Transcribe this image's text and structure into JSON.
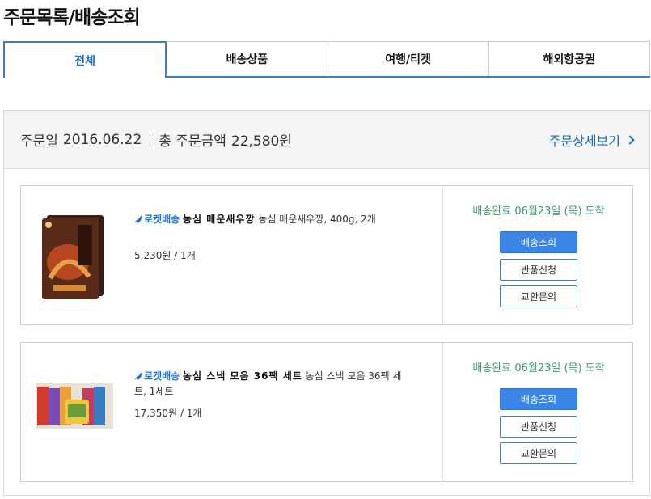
{
  "page": {
    "title": "주문목록/배송조회"
  },
  "tabs": [
    {
      "label": "전체",
      "active": true
    },
    {
      "label": "배송상품",
      "active": false
    },
    {
      "label": "여행/티켓",
      "active": false
    },
    {
      "label": "해외항공권",
      "active": false
    }
  ],
  "order": {
    "date_label": "주문일",
    "date": "2016.06.22",
    "total_label": "총 주문금액",
    "total": "22,580원",
    "detail_link": "주문상세보기",
    "items": [
      {
        "badge": "로켓배송",
        "name": "농심 매운새우깡",
        "desc": "농심 매운새우깡, 400g, 2개",
        "desc_line2": "",
        "price": "5,230원 / 1개",
        "status": "배송완료 06월23일 (목) 도착",
        "track_btn": "배송조회",
        "return_btn": "반품신청",
        "exchange_btn": "교환문의"
      },
      {
        "badge": "로켓배송",
        "name": "농심 스낵 모음 36팩 세트",
        "desc": "농심 스낵 모음 36팩 세",
        "desc_line2": "트, 1세트",
        "price": "17,350원 / 1개",
        "status": "배송완료 06월23일 (목) 도착",
        "track_btn": "배송조회",
        "return_btn": "반품신청",
        "exchange_btn": "교환문의"
      }
    ]
  },
  "colors": {
    "accent": "#1e6fd0",
    "button": "#3a86e6",
    "status": "#3a9a6a"
  },
  "icons": [
    "rocket-icon",
    "chevron-right-icon",
    "product-image"
  ]
}
